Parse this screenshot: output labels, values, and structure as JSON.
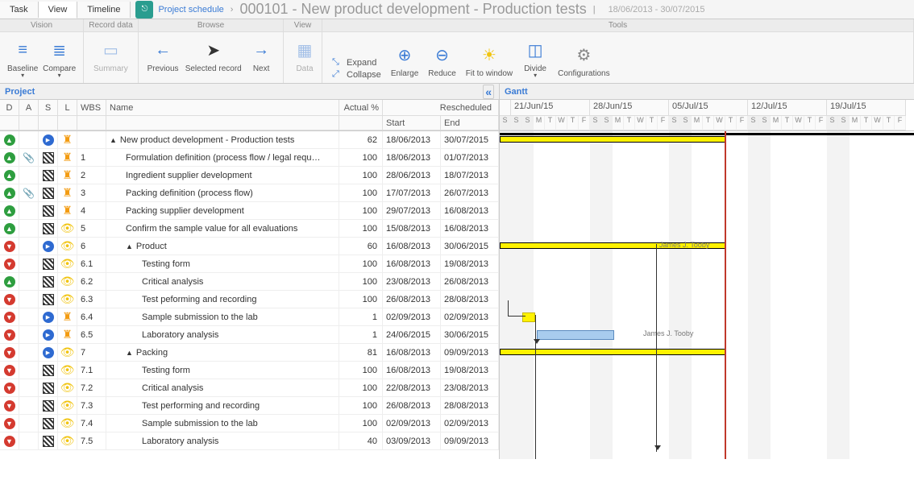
{
  "tabs": {
    "task": "Task",
    "view": "View",
    "timeline": "Timeline"
  },
  "breadcrumb": {
    "root": "Project schedule",
    "sep": "›",
    "title": "000101 - New product development - Production tests",
    "bar": "|",
    "dates": "18/06/2013 - 30/07/2015"
  },
  "ribbon": {
    "groups": {
      "vision": "Vision",
      "record": "Record data",
      "browse": "Browse",
      "view": "View",
      "tools": "Tools"
    },
    "baseline": "Baseline",
    "compare": "Compare",
    "summary": "Summary",
    "previous": "Previous",
    "selected": "Selected record",
    "next": "Next",
    "data": "Data",
    "expand": "Expand",
    "collapse": "Collapse",
    "enlarge": "Enlarge",
    "reduce": "Reduce",
    "fit": "Fit to window",
    "divide": "Divide",
    "config": "Configurations"
  },
  "panels": {
    "project": "Project",
    "gantt": "Gantt"
  },
  "headers": {
    "d": "D",
    "a": "A",
    "s": "S",
    "l": "L",
    "wbs": "WBS",
    "name": "Name",
    "actual": "Actual %",
    "resch": "Rescheduled",
    "start": "Start",
    "end": "End"
  },
  "rows": [
    {
      "d": "gu",
      "a": "",
      "s": "bp",
      "l": "org",
      "wbs": "",
      "indent": 0,
      "tg": "▲",
      "name": "New product development - Production tests",
      "pct": "62",
      "st": "18/06/2013",
      "en": "30/07/2015"
    },
    {
      "d": "gu",
      "a": "clip",
      "s": "flag",
      "l": "org",
      "wbs": "1",
      "indent": 1,
      "name": "Formulation definition (process flow / legal requ…",
      "pct": "100",
      "st": "18/06/2013",
      "en": "01/07/2013"
    },
    {
      "d": "gu",
      "a": "",
      "s": "flag",
      "l": "org",
      "wbs": "2",
      "indent": 1,
      "name": "Ingredient supplier development",
      "pct": "100",
      "st": "28/06/2013",
      "en": "18/07/2013"
    },
    {
      "d": "gu",
      "a": "clip",
      "s": "flag",
      "l": "org",
      "wbs": "3",
      "indent": 1,
      "name": "Packing definition (process flow)",
      "pct": "100",
      "st": "17/07/2013",
      "en": "26/07/2013"
    },
    {
      "d": "gu",
      "a": "",
      "s": "flag",
      "l": "org",
      "wbs": "4",
      "indent": 1,
      "name": "Packing supplier development",
      "pct": "100",
      "st": "29/07/2013",
      "en": "16/08/2013"
    },
    {
      "d": "gu",
      "a": "",
      "s": "flag",
      "l": "yel",
      "wbs": "5",
      "indent": 1,
      "name": "Confirm the sample value for all evaluations",
      "pct": "100",
      "st": "15/08/2013",
      "en": "16/08/2013"
    },
    {
      "d": "rd",
      "a": "",
      "s": "bp",
      "l": "yel",
      "wbs": "6",
      "indent": 1,
      "tg": "▲",
      "name": "Product",
      "pct": "60",
      "st": "16/08/2013",
      "en": "30/06/2015"
    },
    {
      "d": "rd",
      "a": "",
      "s": "flag",
      "l": "yel",
      "wbs": "6.1",
      "indent": 2,
      "name": "Testing form",
      "pct": "100",
      "st": "16/08/2013",
      "en": "19/08/2013"
    },
    {
      "d": "gu",
      "a": "",
      "s": "flag",
      "l": "yel",
      "wbs": "6.2",
      "indent": 2,
      "name": "Critical analysis",
      "pct": "100",
      "st": "23/08/2013",
      "en": "26/08/2013"
    },
    {
      "d": "rd",
      "a": "",
      "s": "flag",
      "l": "yel",
      "wbs": "6.3",
      "indent": 2,
      "name": "Test peforming and recording",
      "pct": "100",
      "st": "26/08/2013",
      "en": "28/08/2013"
    },
    {
      "d": "rd",
      "a": "",
      "s": "bp",
      "l": "org",
      "wbs": "6.4",
      "indent": 2,
      "name": "Sample submission to the lab",
      "pct": "1",
      "st": "02/09/2013",
      "en": "02/09/2013"
    },
    {
      "d": "rd",
      "a": "",
      "s": "bp",
      "l": "org",
      "wbs": "6.5",
      "indent": 2,
      "name": "Laboratory analysis",
      "pct": "1",
      "st": "24/06/2015",
      "en": "30/06/2015"
    },
    {
      "d": "rd",
      "a": "",
      "s": "bp",
      "l": "yel",
      "wbs": "7",
      "indent": 1,
      "tg": "▲",
      "name": "Packing",
      "pct": "81",
      "st": "16/08/2013",
      "en": "09/09/2013"
    },
    {
      "d": "rd",
      "a": "",
      "s": "flag",
      "l": "yel",
      "wbs": "7.1",
      "indent": 2,
      "name": "Testing form",
      "pct": "100",
      "st": "16/08/2013",
      "en": "19/08/2013"
    },
    {
      "d": "rd",
      "a": "",
      "s": "flag",
      "l": "yel",
      "wbs": "7.2",
      "indent": 2,
      "name": "Critical analysis",
      "pct": "100",
      "st": "22/08/2013",
      "en": "23/08/2013"
    },
    {
      "d": "rd",
      "a": "",
      "s": "flag",
      "l": "yel",
      "wbs": "7.3",
      "indent": 2,
      "name": "Test performing and recording",
      "pct": "100",
      "st": "26/08/2013",
      "en": "28/08/2013"
    },
    {
      "d": "rd",
      "a": "",
      "s": "flag",
      "l": "yel",
      "wbs": "7.4",
      "indent": 2,
      "name": "Sample submission to the lab",
      "pct": "100",
      "st": "02/09/2013",
      "en": "02/09/2013"
    },
    {
      "d": "rd",
      "a": "",
      "s": "flag",
      "l": "yel",
      "wbs": "7.5",
      "indent": 2,
      "name": "Laboratory analysis",
      "pct": "40",
      "st": "03/09/2013",
      "en": "09/09/2013"
    }
  ],
  "gantt": {
    "weeks": [
      "21/Jun/15",
      "28/Jun/15",
      "05/Jul/15",
      "12/Jul/15",
      "19/Jul/15"
    ],
    "days": [
      "S",
      "S",
      "M",
      "T",
      "W",
      "T",
      "F"
    ],
    "resource": "James J. Tooby"
  }
}
